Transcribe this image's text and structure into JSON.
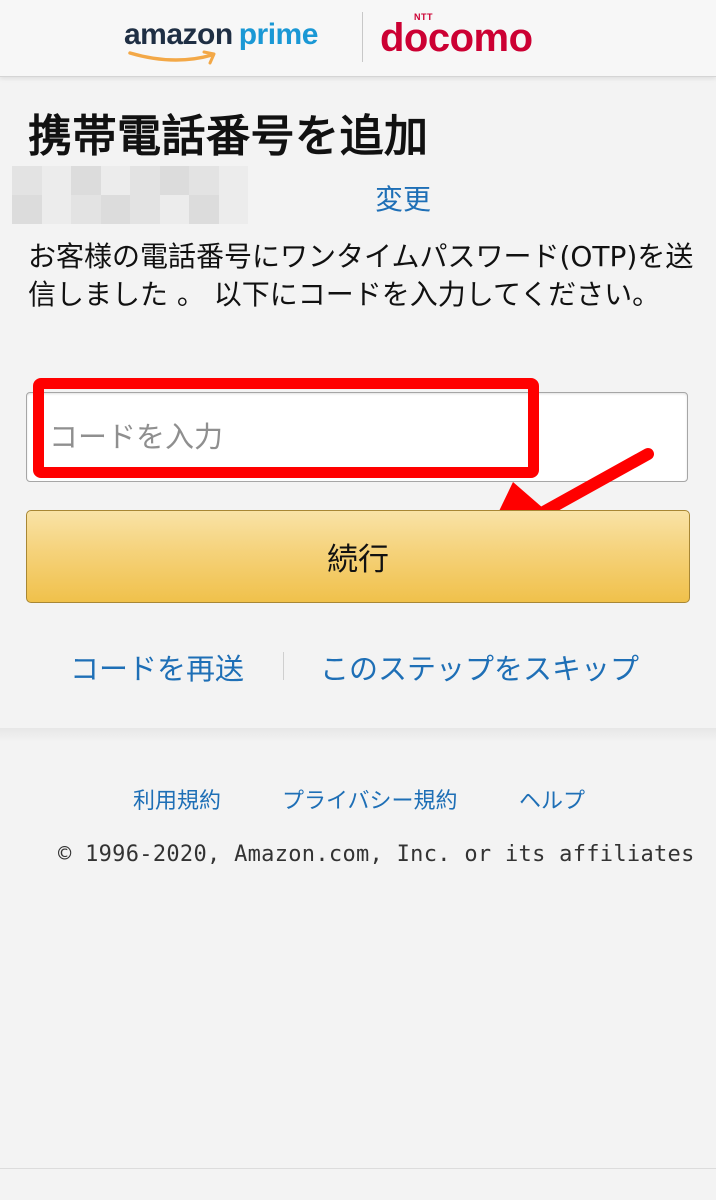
{
  "header": {
    "amazon_logo_word": "amazon",
    "amazon_logo_prime": "prime",
    "docomo_logo_ntt": "NTT",
    "docomo_logo_word": "docomo"
  },
  "page": {
    "title": "携帯電話番号を追加",
    "change_link": "変更",
    "description": "お客様の電話番号にワンタイムパスワード(OTP)を送信しました 。 以下にコードを入力してください。",
    "code_placeholder": "コードを入力",
    "continue_label": "続行",
    "resend_link": "コードを再送",
    "skip_link": "このステップをスキップ"
  },
  "annotation": {
    "highlight_color": "#ff0000"
  },
  "footer": {
    "links": [
      "利用規約",
      "プライバシー規約",
      "ヘルプ"
    ],
    "copyright": "© 1996-2020, Amazon.com, Inc. or its affiliates"
  },
  "colors": {
    "link": "#1e6fb6",
    "button_top": "#f9e3a7",
    "button_bottom": "#f0c14b",
    "docomo_red": "#cc0033",
    "prime_blue": "#1a98d5"
  },
  "icons": [
    "amazon-prime-logo",
    "docomo-logo",
    "red-arrow-icon"
  ]
}
